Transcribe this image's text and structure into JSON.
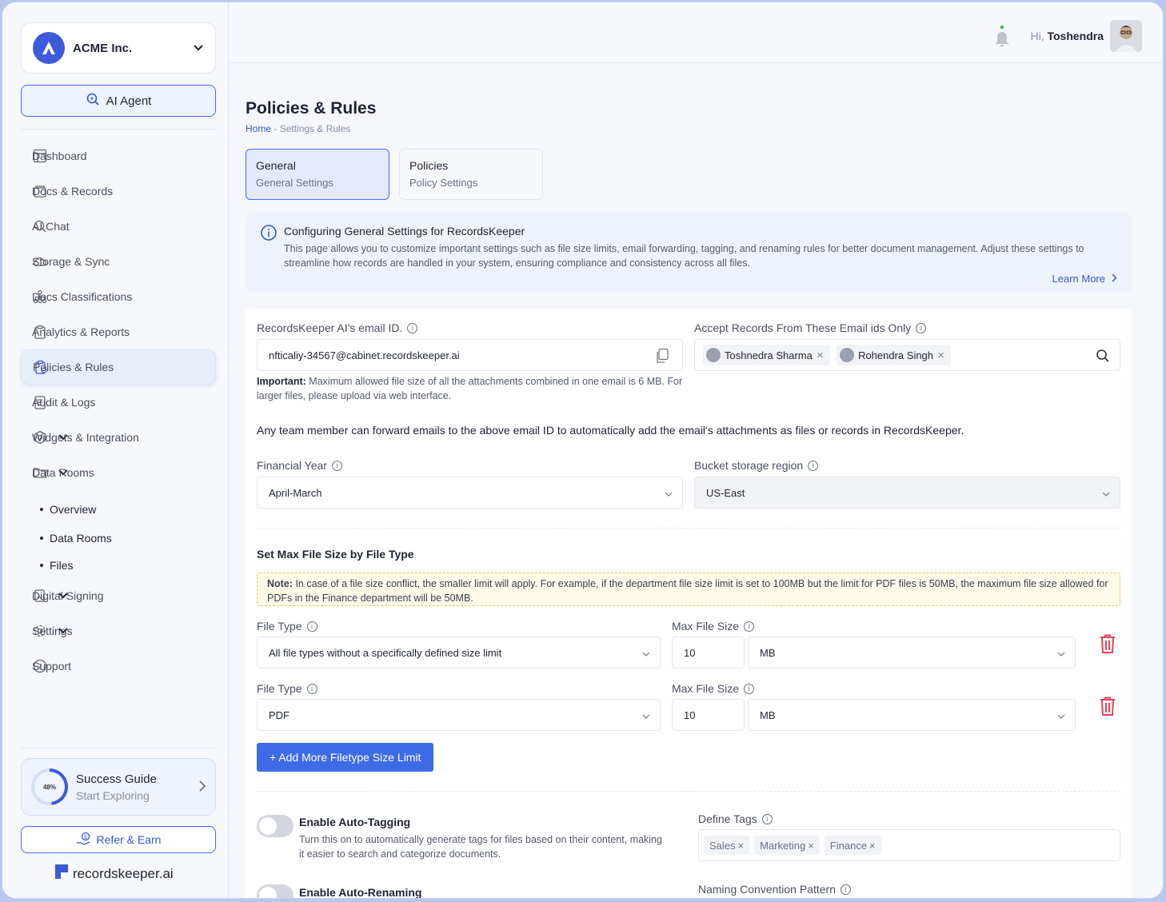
{
  "org": {
    "name": "ACME Inc."
  },
  "sidebar": {
    "ai_agent": "AI Agent",
    "items": [
      {
        "label": "Dashboard"
      },
      {
        "label": "Docs & Records"
      },
      {
        "label": "AI Chat"
      },
      {
        "label": "Storage & Sync"
      },
      {
        "label": "Docs Classifications"
      },
      {
        "label": "Analytics & Reports"
      },
      {
        "label": "Policies & Rules"
      },
      {
        "label": "Audit & Logs"
      },
      {
        "label": "Widgets & Integration"
      },
      {
        "label": "Data Rooms"
      },
      {
        "label": "Digital Signing"
      },
      {
        "label": "Settings"
      },
      {
        "label": "Support"
      }
    ],
    "data_rooms_sub": [
      "Overview",
      "Data Rooms",
      "Files"
    ],
    "guide": {
      "title": "Success Guide",
      "subtitle": "Start Exploring",
      "progress_label": "48%",
      "progress": 0.48
    },
    "refer": "Refer & Earn",
    "brand": "recordskeeper.ai"
  },
  "topbar": {
    "hi": "Hi,",
    "user": "Toshendra"
  },
  "page": {
    "title": "Policies & Rules",
    "crumb_home": "Home",
    "crumb_rest": "- Settings & Rules"
  },
  "tabs": [
    {
      "title": "General",
      "sub": "General Settings"
    },
    {
      "title": "Policies",
      "sub": "Policy Settings"
    }
  ],
  "info": {
    "title": "Configuring General Settings for RecordsKeeper",
    "body": "This page allows you to customize important settings such as file size limits, email forwarding, tagging, and renaming rules for better document management. Adjust these settings to streamline how records are handled in your system, ensuring compliance and consistency across all files.",
    "more": "Learn More"
  },
  "form": {
    "email_label": "RecordsKeeper AI's email ID.",
    "email_value": "nfticaliy-34567@cabinet.recordskeeper.ai",
    "important_bold": "Important:",
    "important_text": "Maximum allowed file size of all the attachments combined in one email is 6 MB. For larger files, please upload via web interface.",
    "accept_label": "Accept Records From These Email ids Only",
    "accept_chips": [
      "Toshnedra Sharma",
      "Rohendra Singh"
    ],
    "forward_text": "Any team member can forward emails to the above email ID to automatically add the email's attachments as files or records in RecordsKeeper.",
    "fy_label": "Financial Year",
    "fy_value": "April-March",
    "region_label": "Bucket storage region",
    "region_value": "US-East",
    "maxsize_heading": "Set Max File Size by File Type",
    "note_bold": "Note:",
    "note_text": "In case of a file size conflict, the smaller limit will apply. For example, if the department file size limit is set to 100MB but the limit for PDF files is 50MB, the maximum file size allowed for PDFs in the Finance department will be 50MB.",
    "rows": [
      {
        "type_label": "File Type",
        "type_value": "All file types without a specifically defined size limit",
        "size_label": "Max File Size",
        "size_value": "10",
        "unit": "MB"
      },
      {
        "type_label": "File Type",
        "type_value": "PDF",
        "size_label": "Max File Size",
        "size_value": "10",
        "unit": "MB"
      }
    ],
    "add_button": "+ Add More Filetype Size Limit",
    "auto_tag_title": "Enable Auto-Tagging",
    "auto_tag_desc": "Turn this on to automatically generate tags for files based on their content, making it easier to search and categorize documents.",
    "define_tags_label": "Define Tags",
    "tags": [
      "Sales",
      "Marketing",
      "Finance"
    ],
    "auto_rename_title": "Enable Auto-Renaming",
    "naming_label": "Naming Convention Pattern"
  }
}
